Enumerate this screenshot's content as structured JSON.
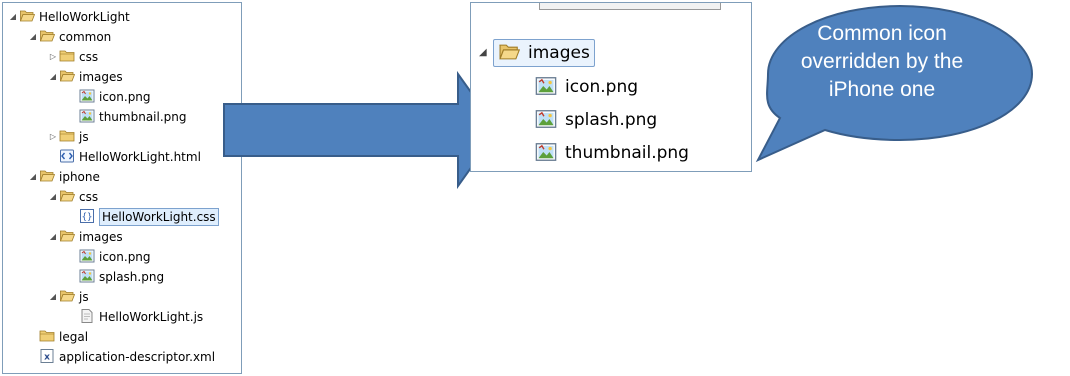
{
  "tree": {
    "items": [
      {
        "label": "HelloWorkLight",
        "icon": "open-folder-icon",
        "twisty": "expanded"
      },
      {
        "label": "common",
        "icon": "open-folder-icon",
        "twisty": "expanded"
      },
      {
        "label": "css",
        "icon": "folder-icon",
        "twisty": "collapsed"
      },
      {
        "label": "images",
        "icon": "open-folder-icon",
        "twisty": "expanded"
      },
      {
        "label": "icon.png",
        "icon": "image-file-icon"
      },
      {
        "label": "thumbnail.png",
        "icon": "image-file-icon"
      },
      {
        "label": "js",
        "icon": "folder-icon",
        "twisty": "collapsed"
      },
      {
        "label": "HelloWorkLight.html",
        "icon": "html-file-icon"
      },
      {
        "label": "iphone",
        "icon": "open-folder-icon",
        "twisty": "expanded"
      },
      {
        "label": "css",
        "icon": "open-folder-icon",
        "twisty": "expanded"
      },
      {
        "label": "HelloWorkLight.css",
        "icon": "css-file-icon",
        "selected": true
      },
      {
        "label": "images",
        "icon": "open-folder-icon",
        "twisty": "expanded"
      },
      {
        "label": "icon.png",
        "icon": "image-file-icon"
      },
      {
        "label": "splash.png",
        "icon": "image-file-icon"
      },
      {
        "label": "js",
        "icon": "open-folder-icon",
        "twisty": "expanded"
      },
      {
        "label": "HelloWorkLight.js",
        "icon": "js-file-icon"
      },
      {
        "label": "legal",
        "icon": "folder-icon"
      },
      {
        "label": "application-descriptor.xml",
        "icon": "xml-file-icon"
      }
    ]
  },
  "zoom": {
    "folder": {
      "label": "images",
      "icon": "open-folder-icon",
      "twisty": "expanded"
    },
    "items": [
      {
        "label": "icon.png",
        "icon": "image-file-icon"
      },
      {
        "label": "splash.png",
        "icon": "image-file-icon"
      },
      {
        "label": "thumbnail.png",
        "icon": "image-file-icon"
      }
    ]
  },
  "callout": {
    "text": "Common icon\noverridden by the\niPhone one",
    "fill": "#4f81bd",
    "stroke": "#385d8a"
  },
  "arrow": {
    "fill": "#4f81bd",
    "stroke": "#385d8a"
  }
}
